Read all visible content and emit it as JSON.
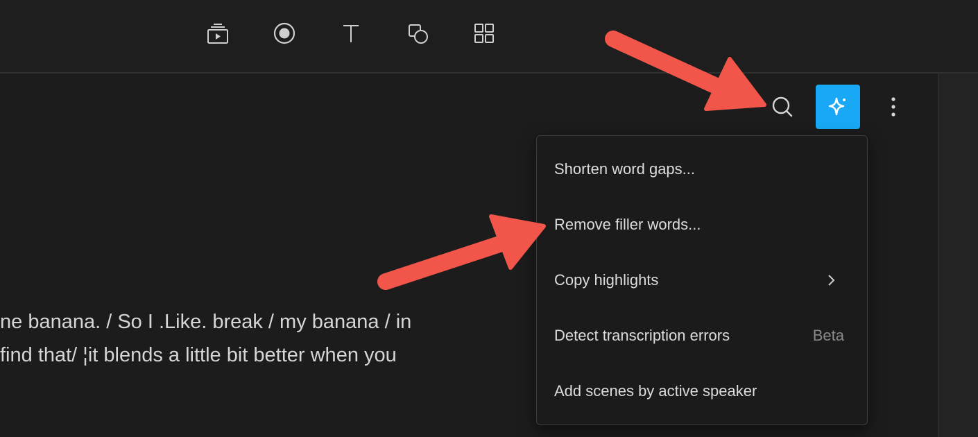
{
  "toolbar": {
    "tools": [
      {
        "icon": "media-icon"
      },
      {
        "icon": "record-icon"
      },
      {
        "icon": "text-icon"
      },
      {
        "icon": "shapes-icon"
      },
      {
        "icon": "elements-grid-icon"
      }
    ]
  },
  "header_actions": {
    "search_icon": "search-icon",
    "ai_icon": "sparkle-icon",
    "more_icon": "more-vertical-icon",
    "ai_button_color": "#18a8f5"
  },
  "menu": {
    "items": [
      {
        "label": "Shorten word gaps..."
      },
      {
        "label": "Remove filler words..."
      },
      {
        "label": "Copy highlights",
        "submenu": true
      },
      {
        "label": "Detect transcription errors",
        "badge": "Beta"
      },
      {
        "label": "Add scenes by active speaker"
      }
    ]
  },
  "transcript": {
    "line1": "ne banana. / So I .Like. break / my banana / in",
    "line2": " find that/  ¦it blends a little bit better when you"
  },
  "annotation_color": "#f2564b"
}
